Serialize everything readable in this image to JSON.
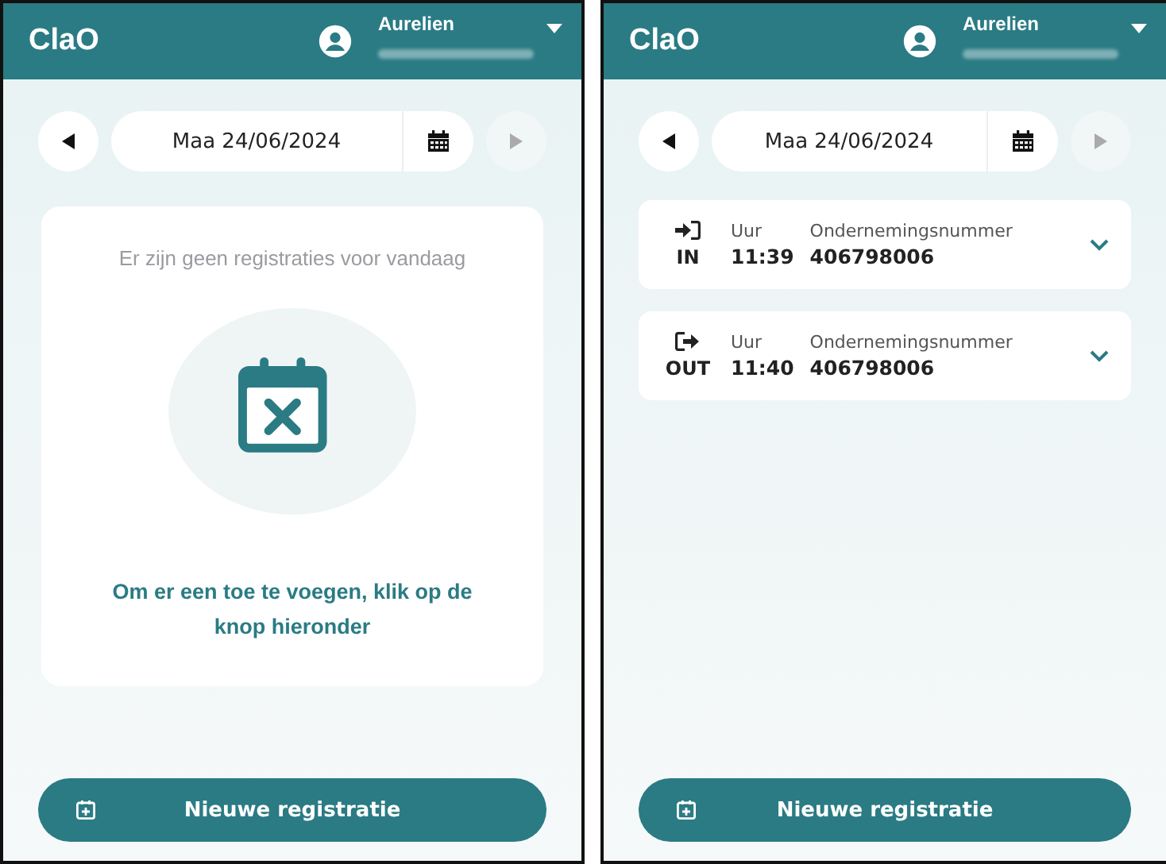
{
  "screens": [
    {
      "kind": "empty",
      "header": {
        "logo": "ClaO",
        "user": "Aurelien"
      },
      "date_nav": {
        "date": "Maa 24/06/2024",
        "prev_disabled": false,
        "next_disabled": true
      },
      "empty_state": {
        "message": "Er zijn geen registraties voor vandaag",
        "hint": "Om er een toe te voegen, klik op de knop hieronder"
      },
      "button": "Nieuwe registratie"
    },
    {
      "kind": "list",
      "header": {
        "logo": "ClaO",
        "user": "Aurelien"
      },
      "date_nav": {
        "date": "Maa 24/06/2024",
        "prev_disabled": false,
        "next_disabled": true
      },
      "entries": [
        {
          "kind": "in",
          "label": "IN",
          "time_label": "Uur",
          "time": "11:39",
          "number_label": "Ondernemingsnummer",
          "number": "406798006"
        },
        {
          "kind": "out",
          "label": "OUT",
          "time_label": "Uur",
          "time": "11:40",
          "number_label": "Ondernemingsnummer",
          "number": "406798006"
        }
      ],
      "button": "Nieuwe registratie"
    }
  ]
}
